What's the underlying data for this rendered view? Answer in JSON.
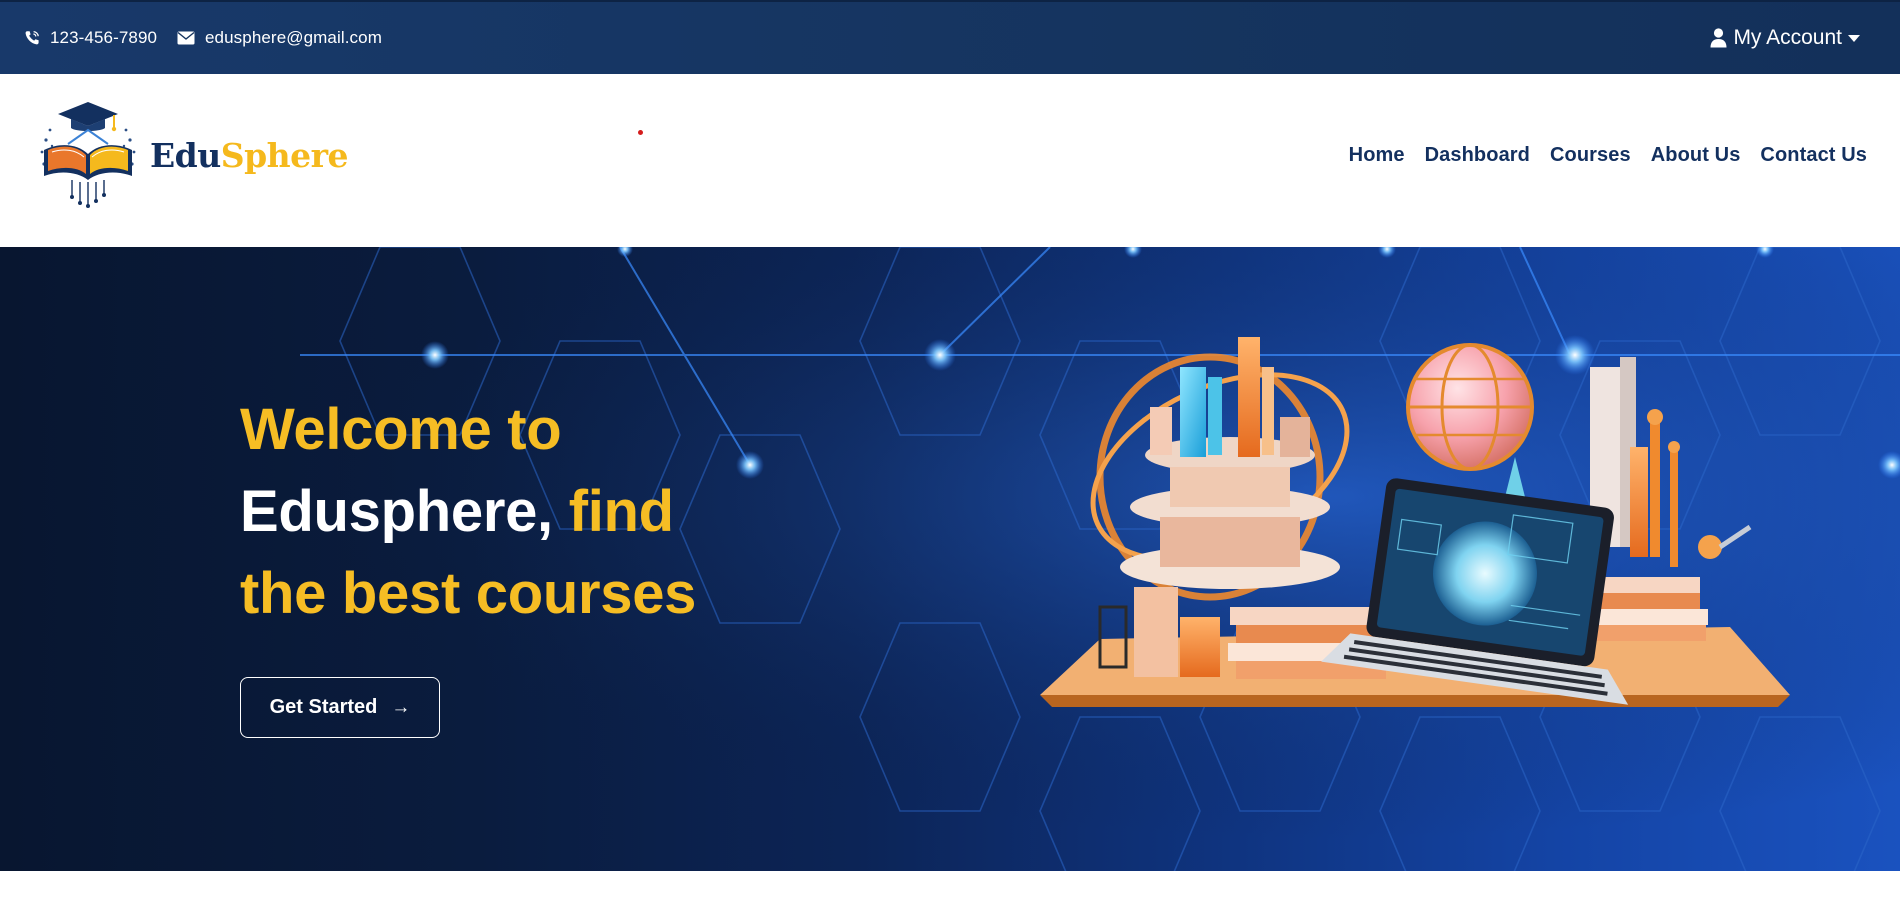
{
  "topbar": {
    "phone": "123-456-7890",
    "email": "edusphere@gmail.com",
    "account_label": "My Account",
    "phone_icon": "phone-icon",
    "email_icon": "envelope-icon",
    "account_icon": "user-icon",
    "background_color": "#15345f"
  },
  "header": {
    "brand_part1": "Edu",
    "brand_part2": "Sphere",
    "brand_color_primary": "#13305f",
    "brand_color_accent": "#f5b91d",
    "nav": [
      "Home",
      "Dashboard",
      "Courses",
      "About Us",
      "Contact Us"
    ]
  },
  "hero": {
    "title_line1": "Welcome to",
    "title_line2_white": "Edusphere,",
    "title_line2_yellow": "find",
    "title_line3": "the best courses",
    "cta_label": "Get Started",
    "cta_icon": "arrow-right-icon",
    "accent_color": "#f6bd24"
  }
}
